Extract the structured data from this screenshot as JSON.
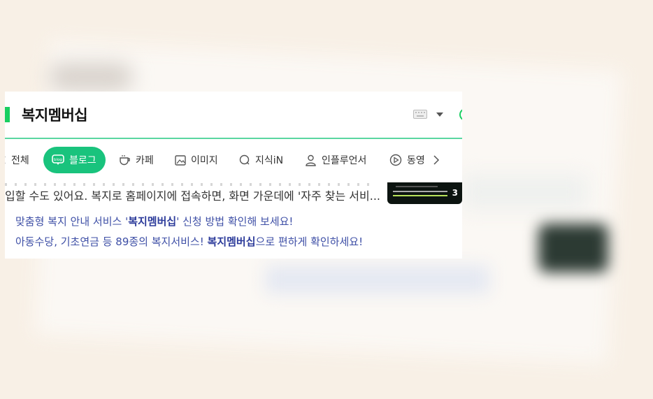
{
  "search": {
    "query": "복지멤버십"
  },
  "tabs": [
    {
      "label": "전체",
      "icon": "all-icon"
    },
    {
      "label": "블로그",
      "icon": "blog-icon",
      "active": true
    },
    {
      "label": "카페",
      "icon": "cafe-icon"
    },
    {
      "label": "이미지",
      "icon": "image-icon"
    },
    {
      "label": "지식iN",
      "icon": "kin-icon"
    },
    {
      "label": "인플루언서",
      "icon": "person-icon"
    },
    {
      "label": "동영",
      "icon": "play-icon"
    }
  ],
  "result": {
    "snippet": "입할 수도 있어요. 복지로 홈페이지에 접속하면, 화면 가운데에 '자주 찾는 서비...",
    "thumbnail_badge": "3",
    "links": [
      {
        "pre": "맞춤형 복지 안내 서비스 '",
        "bold": "복지멤버십",
        "post": "' 신청 방법 확인해 보세요!"
      },
      {
        "pre": "아동수당, 기초연금 등 89종의 복지서비스! ",
        "bold": "복지멤버십",
        "post": "으로 편하게 확인하세요!"
      }
    ]
  },
  "colors": {
    "accent": "#19ce60",
    "active_tab": "#19c37d",
    "link": "#3e4fa6"
  }
}
